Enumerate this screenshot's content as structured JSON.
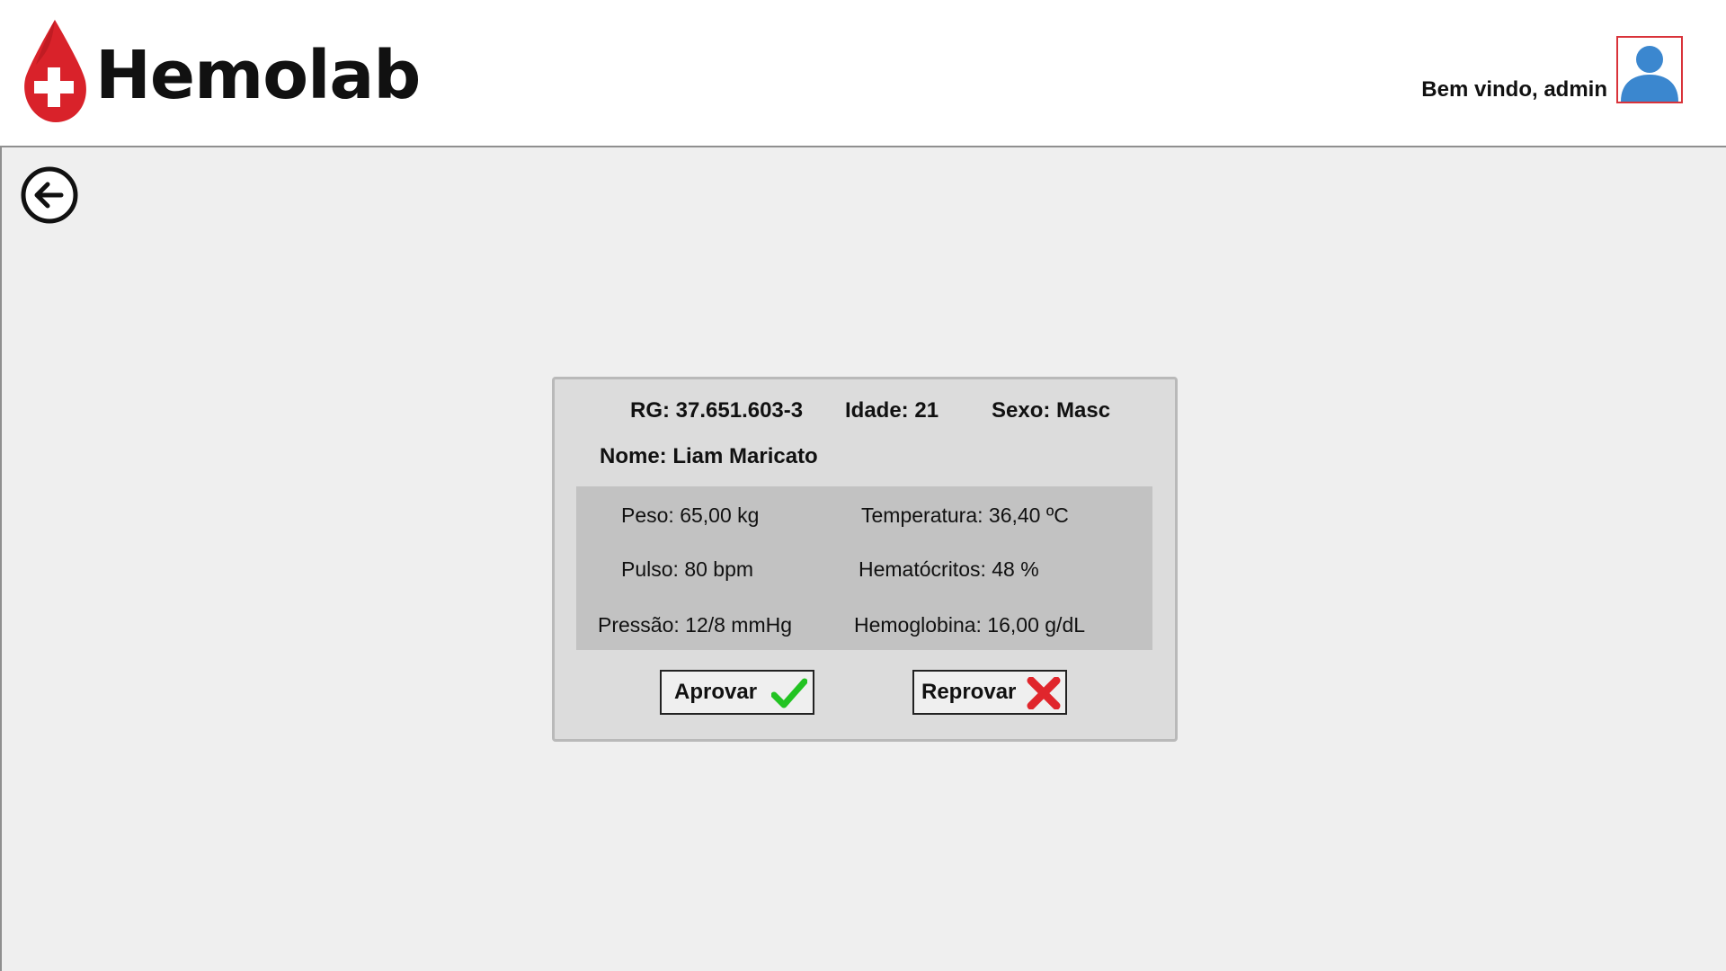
{
  "header": {
    "logo_text": "Hemolab",
    "welcome_text": "Bem vindo, admin"
  },
  "patient": {
    "rg": "RG: 37.651.603-3",
    "idade": "Idade: 21",
    "sexo": "Sexo: Masc",
    "nome": "Nome: Liam Maricato"
  },
  "vitals": {
    "peso": "Peso: 65,00 kg",
    "temperatura": "Temperatura: 36,40 ºC",
    "pulso": "Pulso: 80 bpm",
    "hematocritos": "Hematócritos: 48 %",
    "pressao": "Pressão: 12/8 mmHg",
    "hemoglobina": "Hemoglobina: 16,00 g/dL"
  },
  "actions": {
    "approve_label": "Aprovar",
    "reject_label": "Reprovar"
  },
  "colors": {
    "brand_red": "#d9222a",
    "avatar_blue": "#3b87cf",
    "approve_green": "#22c322",
    "reject_red": "#e0262c"
  },
  "icons": {
    "back": "arrow-left-circle-icon",
    "avatar": "user-icon",
    "approve": "checkmark-icon",
    "reject": "x-mark-icon",
    "logo": "blood-drop-cross-icon"
  }
}
